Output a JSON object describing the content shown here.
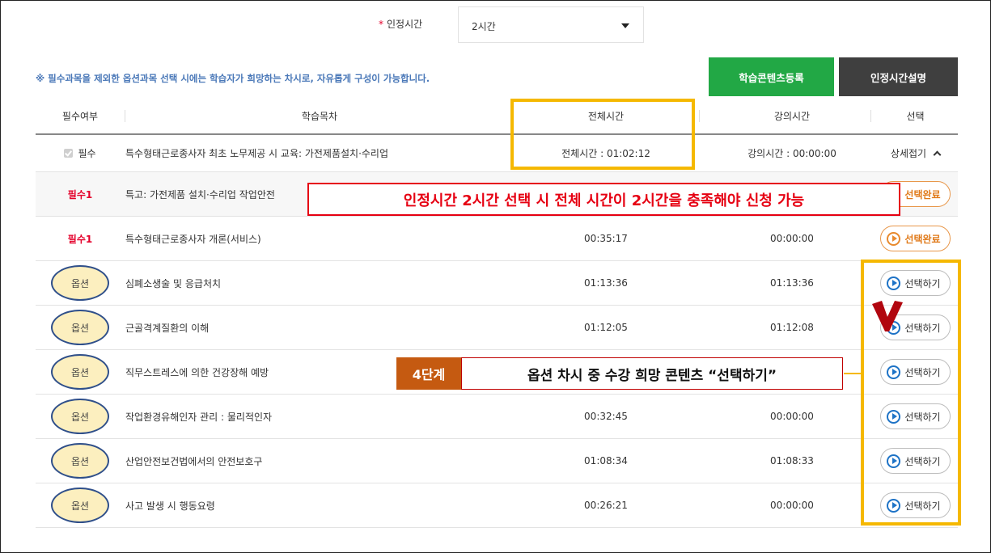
{
  "form": {
    "required_mark": "*",
    "label": "인정시간",
    "selected_value": "2시간"
  },
  "notice": "※ 필수과목을 제외한 옵션과목 선택 시에는 학습자가 희망하는 차시로, 자유롭게 구성이 가능합니다.",
  "buttons": {
    "register": "학습콘텐츠등록",
    "explain": "인정시간설명"
  },
  "table": {
    "headers": [
      "필수여부",
      "학습목차",
      "전체시간",
      "강의시간",
      "선택"
    ],
    "main_row": {
      "required": "필수",
      "title": "특수형태근로종사자 최초 노무제공 시 교육: 가전제품설치·수리업",
      "total": "전체시간 : 01:02:12",
      "lecture": "강의시간 : 00:00:00",
      "action": "상세접기"
    },
    "rows": [
      {
        "tag": "필수1",
        "title": "특고: 가전제품 설치·수리업 작업안전",
        "total": "",
        "lecture": "",
        "action": "선택완료"
      },
      {
        "tag": "필수1",
        "title": "특수형태근로종사자 개론(서비스)",
        "total": "00:35:17",
        "lecture": "00:00:00",
        "action": "선택완료"
      },
      {
        "tag": "옵션",
        "title": "심폐소생술 및 응급처치",
        "total": "01:13:36",
        "lecture": "01:13:36",
        "action": "선택하기"
      },
      {
        "tag": "옵션",
        "title": "근골격계질환의 이해",
        "total": "01:12:05",
        "lecture": "01:12:08",
        "action": "선택하기"
      },
      {
        "tag": "옵션",
        "title": "직무스트레스에 의한 건강장해 예방",
        "total": "",
        "lecture": "",
        "action": "선택하기"
      },
      {
        "tag": "옵션",
        "title": "작업환경유해인자 관리 : 물리적인자",
        "total": "00:32:45",
        "lecture": "00:00:00",
        "action": "선택하기"
      },
      {
        "tag": "옵션",
        "title": "산업안전보건법에서의 안전보호구",
        "total": "01:08:34",
        "lecture": "01:08:33",
        "action": "선택하기"
      },
      {
        "tag": "옵션",
        "title": "사고 발생 시 행동요령",
        "total": "00:26:21",
        "lecture": "00:00:00",
        "action": "선택하기"
      }
    ]
  },
  "annotations": {
    "red_callout": "인정시간 2시간 선택 시 전체 시간이 2시간을 충족해야 신청 가능",
    "step_tag": "4단계",
    "step_text": "옵션 차시 중 수강 희망 콘텐츠 “선택하기”"
  },
  "colors": {
    "green": "#22a845",
    "dark": "#3f3f3f",
    "highlight": "#f5b800",
    "required_red": "#e4002b",
    "step_orange": "#c55a11",
    "notice_blue": "#4a78b8"
  }
}
